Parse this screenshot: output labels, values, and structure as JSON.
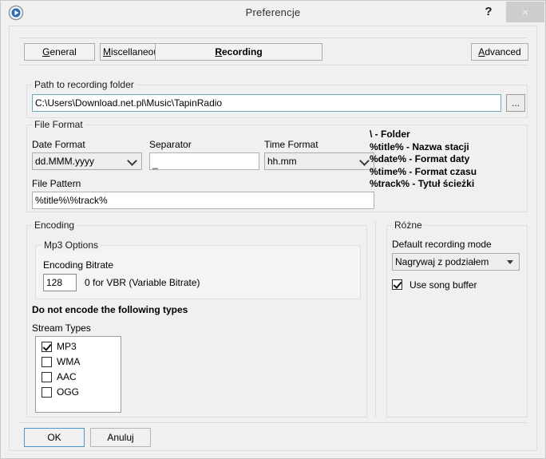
{
  "window": {
    "title": "Preferencje",
    "app_icon": "play-circle-icon",
    "help_label": "?",
    "close_label": "×"
  },
  "tabs": [
    {
      "label": "General",
      "accel": "G",
      "rest": "eneral",
      "active": false
    },
    {
      "label": "Miscellaneous",
      "accel": "M",
      "rest": "iscellaneous",
      "active": false
    },
    {
      "label": "Recording",
      "accel": "R",
      "rest": "ecording",
      "active": true
    }
  ],
  "advanced_button": {
    "accel": "A",
    "rest": "dvanced",
    "label": "Advanced"
  },
  "path_group": {
    "title": "Path to recording folder",
    "value": "C:\\Users\\Download.net.pl\\Music\\TapinRadio",
    "browse_label": "..."
  },
  "file_format": {
    "title": "File Format",
    "date_format": {
      "label": "Date Format",
      "value": "dd.MMM.yyyy"
    },
    "separator": {
      "label": "Separator",
      "value": "_"
    },
    "time_format": {
      "label": "Time Format",
      "value": "hh.mm"
    },
    "file_pattern": {
      "label": "File Pattern",
      "value": "%title%\\%track%"
    }
  },
  "legend": {
    "lines": [
      "\\ - Folder",
      "%title% - Nazwa stacji",
      "%date% - Format daty",
      "%time% - Format czasu",
      "%track% - Tytuł ścieżki"
    ]
  },
  "encoding": {
    "title": "Encoding",
    "mp3_options": {
      "title": "Mp3 Options",
      "bitrate_label": "Encoding Bitrate",
      "bitrate_value": "128",
      "bitrate_hint": "0 for VBR (Variable Bitrate)"
    },
    "no_encode_heading": "Do not encode the following types",
    "stream_types_label": "Stream Types",
    "stream_types": [
      {
        "label": "MP3",
        "checked": true
      },
      {
        "label": "WMA",
        "checked": false
      },
      {
        "label": "AAC",
        "checked": false
      },
      {
        "label": "OGG",
        "checked": false
      }
    ]
  },
  "misc": {
    "title": "Różne",
    "recording_mode_label": "Default recording mode",
    "recording_mode_value": "Nagrywaj z podziałem",
    "song_buffer": {
      "label": "Use song buffer",
      "checked": true
    }
  },
  "footer": {
    "ok_label": "OK",
    "cancel_label": "Anuluj"
  },
  "colors": {
    "dialog_bg": "#f0f0f0",
    "field_bg": "#ffffff",
    "accent_focus": "#4f94c8",
    "icon_blue": "#2f6fb5",
    "close_bg": "#cdcdcd"
  }
}
